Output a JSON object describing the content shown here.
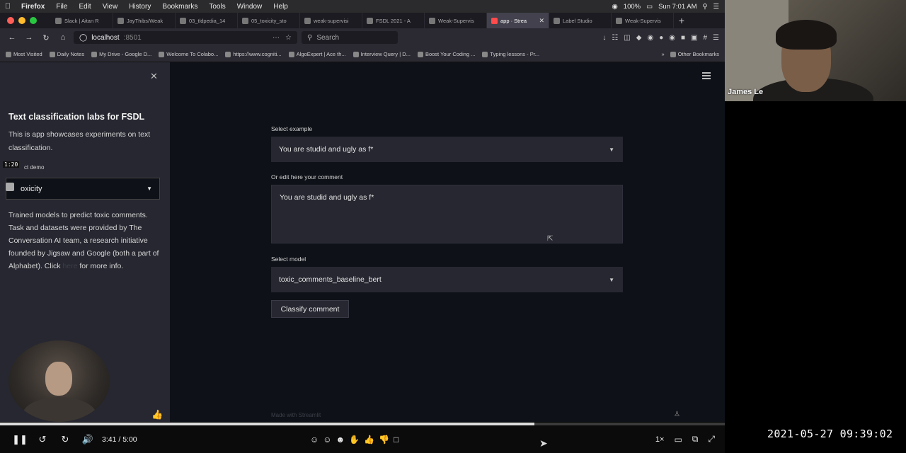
{
  "menubar": {
    "app": "Firefox",
    "items": [
      "File",
      "Edit",
      "View",
      "History",
      "Bookmarks",
      "Tools",
      "Window",
      "Help"
    ],
    "battery": "100%",
    "clock": "Sun 7:01 AM"
  },
  "tabs": [
    {
      "label": "Slack | Aitan R",
      "active": false
    },
    {
      "label": "JayThibs/Weak",
      "active": false
    },
    {
      "label": "03_tldpedia_14",
      "active": false
    },
    {
      "label": "05_toxicity_sto",
      "active": false
    },
    {
      "label": "weak-supervisi",
      "active": false
    },
    {
      "label": "FSDL 2021 - A",
      "active": false
    },
    {
      "label": "Weak-Supervis",
      "active": false
    },
    {
      "label": "app · Strea",
      "active": true
    },
    {
      "label": "Label Studio",
      "active": false
    },
    {
      "label": "Weak-Supervis",
      "active": false
    }
  ],
  "nav": {
    "url_host": "localhost",
    "url_port": ":8501",
    "search_placeholder": "Search"
  },
  "bookmarks": [
    "Most Visited",
    "Daily Notes",
    "My Drive - Google D...",
    "Welcome To Colabo...",
    "https://www.cogniti...",
    "AlgoExpert | Ace th...",
    "Interview Query | D...",
    "Boost Your Coding ...",
    "Typing lessons - Pr..."
  ],
  "bookmarks_other": "Other Bookmarks",
  "sidebar": {
    "title": "Text classification labs for FSDL",
    "description": "This is app showcases experiments on text classification.",
    "select_label": "ct demo",
    "timestamp_badge": "1:20",
    "select_value": "oxicity",
    "info_text": "Trained models to predict toxic comments. Task and datasets were provided by The Conversation AI team, a research initiative founded by Jigsaw and Google (both a part of Alphabet). Click ",
    "info_link": "here",
    "info_suffix": " for more info."
  },
  "main": {
    "example_label": "Select example",
    "example_value": "You are studid and ugly as f*",
    "comment_label": "Or edit here your comment",
    "comment_value": "You are studid and ugly as f*",
    "model_label": "Select model",
    "model_value": "toxic_comments_baseline_bert",
    "classify_button": "Classify comment",
    "footer": "Made with Streamlit"
  },
  "video": {
    "time": "3:41 / 5:00",
    "progress": 0.737,
    "speed": "1×"
  },
  "webcam": {
    "name": "James Le"
  },
  "recording_timestamp": "2021-05-27 09:39:02"
}
